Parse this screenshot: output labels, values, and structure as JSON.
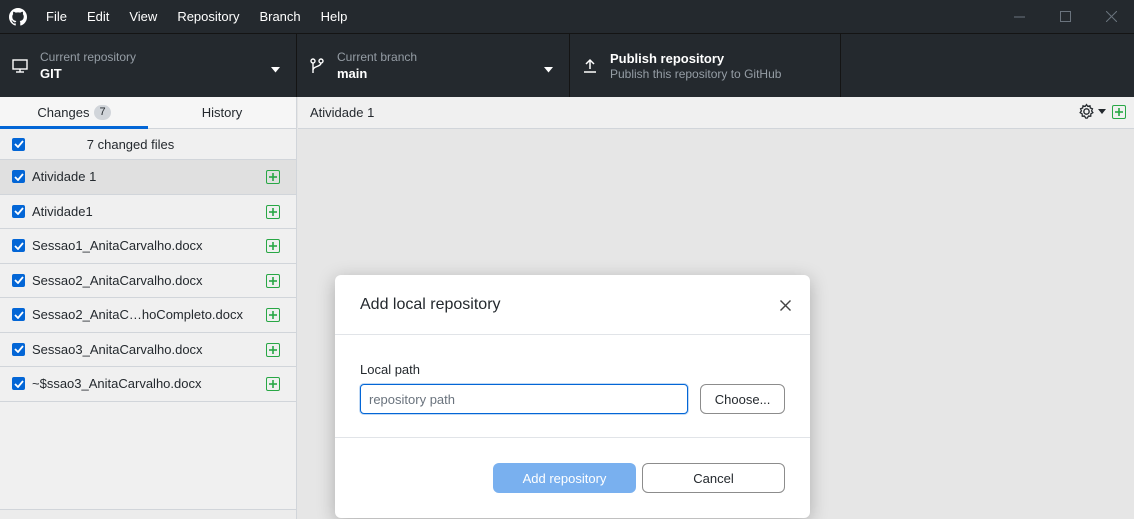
{
  "app": {
    "menu": [
      "File",
      "Edit",
      "View",
      "Repository",
      "Branch",
      "Help"
    ]
  },
  "toolbar": {
    "repository": {
      "label": "Current repository",
      "value": "GIT"
    },
    "branch": {
      "label": "Current branch",
      "value": "main"
    },
    "publish": {
      "label": "Publish repository",
      "description": "Publish this repository to GitHub"
    }
  },
  "sidebar": {
    "tabs": [
      {
        "label": "Changes",
        "count": "7"
      },
      {
        "label": "History"
      }
    ],
    "changed_files_text": "7 changed files",
    "files": [
      {
        "name": "Atividade 1",
        "selected": true
      },
      {
        "name": "Atividade1",
        "selected": false
      },
      {
        "name": "Sessao1_AnitaCarvalho.docx",
        "selected": false
      },
      {
        "name": "Sessao2_AnitaCarvalho.docx",
        "selected": false
      },
      {
        "name": "Sessao2_AnitaC…hoCompleto.docx",
        "selected": false
      },
      {
        "name": "Sessao3_AnitaCarvalho.docx",
        "selected": false
      },
      {
        "name": "~$ssao3_AnitaCarvalho.docx",
        "selected": false
      }
    ]
  },
  "main": {
    "current_path": "Atividade 1"
  },
  "dialog": {
    "title": "Add local repository",
    "field_label": "Local path",
    "input_placeholder": "repository path",
    "input_value": "",
    "choose_label": "Choose...",
    "primary_label": "Add repository",
    "cancel_label": "Cancel"
  },
  "colors": {
    "titlebar": "#24292e",
    "accent": "#0366d6",
    "added": "#28a745",
    "primary_disabled": "#79b0ef"
  }
}
